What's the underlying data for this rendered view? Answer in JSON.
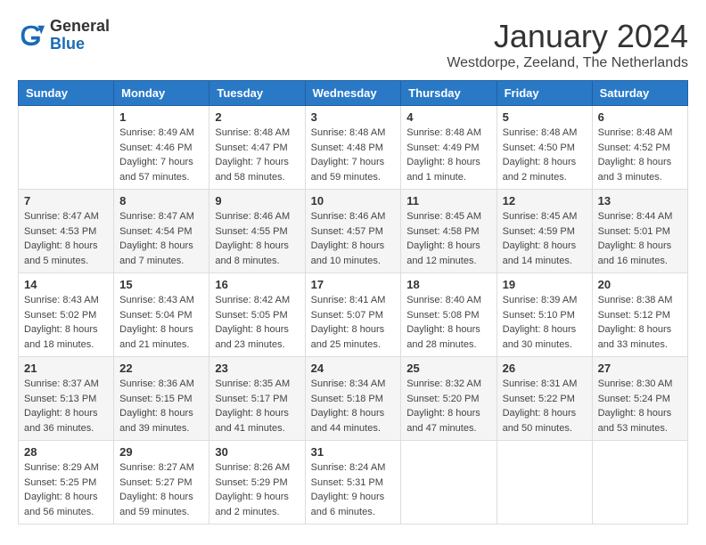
{
  "header": {
    "logo": {
      "general": "General",
      "blue": "Blue"
    },
    "title": "January 2024",
    "location": "Westdorpe, Zeeland, The Netherlands"
  },
  "calendar": {
    "weekdays": [
      "Sunday",
      "Monday",
      "Tuesday",
      "Wednesday",
      "Thursday",
      "Friday",
      "Saturday"
    ],
    "weeks": [
      [
        {
          "day": "",
          "info": ""
        },
        {
          "day": "1",
          "info": "Sunrise: 8:49 AM\nSunset: 4:46 PM\nDaylight: 7 hours\nand 57 minutes."
        },
        {
          "day": "2",
          "info": "Sunrise: 8:48 AM\nSunset: 4:47 PM\nDaylight: 7 hours\nand 58 minutes."
        },
        {
          "day": "3",
          "info": "Sunrise: 8:48 AM\nSunset: 4:48 PM\nDaylight: 7 hours\nand 59 minutes."
        },
        {
          "day": "4",
          "info": "Sunrise: 8:48 AM\nSunset: 4:49 PM\nDaylight: 8 hours\nand 1 minute."
        },
        {
          "day": "5",
          "info": "Sunrise: 8:48 AM\nSunset: 4:50 PM\nDaylight: 8 hours\nand 2 minutes."
        },
        {
          "day": "6",
          "info": "Sunrise: 8:48 AM\nSunset: 4:52 PM\nDaylight: 8 hours\nand 3 minutes."
        }
      ],
      [
        {
          "day": "7",
          "info": "Sunrise: 8:47 AM\nSunset: 4:53 PM\nDaylight: 8 hours\nand 5 minutes."
        },
        {
          "day": "8",
          "info": "Sunrise: 8:47 AM\nSunset: 4:54 PM\nDaylight: 8 hours\nand 7 minutes."
        },
        {
          "day": "9",
          "info": "Sunrise: 8:46 AM\nSunset: 4:55 PM\nDaylight: 8 hours\nand 8 minutes."
        },
        {
          "day": "10",
          "info": "Sunrise: 8:46 AM\nSunset: 4:57 PM\nDaylight: 8 hours\nand 10 minutes."
        },
        {
          "day": "11",
          "info": "Sunrise: 8:45 AM\nSunset: 4:58 PM\nDaylight: 8 hours\nand 12 minutes."
        },
        {
          "day": "12",
          "info": "Sunrise: 8:45 AM\nSunset: 4:59 PM\nDaylight: 8 hours\nand 14 minutes."
        },
        {
          "day": "13",
          "info": "Sunrise: 8:44 AM\nSunset: 5:01 PM\nDaylight: 8 hours\nand 16 minutes."
        }
      ],
      [
        {
          "day": "14",
          "info": "Sunrise: 8:43 AM\nSunset: 5:02 PM\nDaylight: 8 hours\nand 18 minutes."
        },
        {
          "day": "15",
          "info": "Sunrise: 8:43 AM\nSunset: 5:04 PM\nDaylight: 8 hours\nand 21 minutes."
        },
        {
          "day": "16",
          "info": "Sunrise: 8:42 AM\nSunset: 5:05 PM\nDaylight: 8 hours\nand 23 minutes."
        },
        {
          "day": "17",
          "info": "Sunrise: 8:41 AM\nSunset: 5:07 PM\nDaylight: 8 hours\nand 25 minutes."
        },
        {
          "day": "18",
          "info": "Sunrise: 8:40 AM\nSunset: 5:08 PM\nDaylight: 8 hours\nand 28 minutes."
        },
        {
          "day": "19",
          "info": "Sunrise: 8:39 AM\nSunset: 5:10 PM\nDaylight: 8 hours\nand 30 minutes."
        },
        {
          "day": "20",
          "info": "Sunrise: 8:38 AM\nSunset: 5:12 PM\nDaylight: 8 hours\nand 33 minutes."
        }
      ],
      [
        {
          "day": "21",
          "info": "Sunrise: 8:37 AM\nSunset: 5:13 PM\nDaylight: 8 hours\nand 36 minutes."
        },
        {
          "day": "22",
          "info": "Sunrise: 8:36 AM\nSunset: 5:15 PM\nDaylight: 8 hours\nand 39 minutes."
        },
        {
          "day": "23",
          "info": "Sunrise: 8:35 AM\nSunset: 5:17 PM\nDaylight: 8 hours\nand 41 minutes."
        },
        {
          "day": "24",
          "info": "Sunrise: 8:34 AM\nSunset: 5:18 PM\nDaylight: 8 hours\nand 44 minutes."
        },
        {
          "day": "25",
          "info": "Sunrise: 8:32 AM\nSunset: 5:20 PM\nDaylight: 8 hours\nand 47 minutes."
        },
        {
          "day": "26",
          "info": "Sunrise: 8:31 AM\nSunset: 5:22 PM\nDaylight: 8 hours\nand 50 minutes."
        },
        {
          "day": "27",
          "info": "Sunrise: 8:30 AM\nSunset: 5:24 PM\nDaylight: 8 hours\nand 53 minutes."
        }
      ],
      [
        {
          "day": "28",
          "info": "Sunrise: 8:29 AM\nSunset: 5:25 PM\nDaylight: 8 hours\nand 56 minutes."
        },
        {
          "day": "29",
          "info": "Sunrise: 8:27 AM\nSunset: 5:27 PM\nDaylight: 8 hours\nand 59 minutes."
        },
        {
          "day": "30",
          "info": "Sunrise: 8:26 AM\nSunset: 5:29 PM\nDaylight: 9 hours\nand 2 minutes."
        },
        {
          "day": "31",
          "info": "Sunrise: 8:24 AM\nSunset: 5:31 PM\nDaylight: 9 hours\nand 6 minutes."
        },
        {
          "day": "",
          "info": ""
        },
        {
          "day": "",
          "info": ""
        },
        {
          "day": "",
          "info": ""
        }
      ]
    ]
  }
}
